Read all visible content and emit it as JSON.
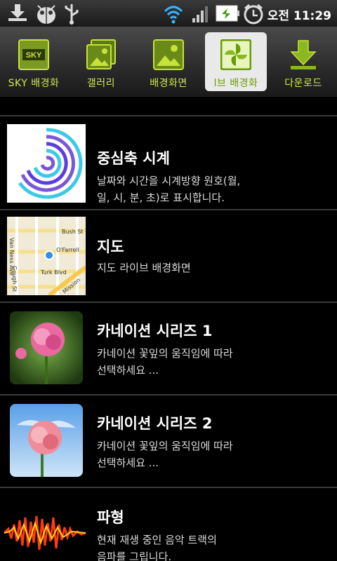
{
  "status_bar": {
    "time": "오전 11:29",
    "icons": [
      "download-icon",
      "bug-icon",
      "usb-icon",
      "wifi-icon",
      "signal-icon",
      "battery-charging-icon",
      "alarm-icon"
    ]
  },
  "tabs": [
    {
      "label": "SKY 배경화",
      "icon_text": "SKY",
      "icon": "sky-icon"
    },
    {
      "label": "갤러리",
      "icon": "gallery-icon"
    },
    {
      "label": "배경화면",
      "icon": "wallpaper-icon"
    },
    {
      "label": "l브 배경화",
      "icon": "live-wallpaper-icon",
      "active": true
    },
    {
      "label": "다운로드",
      "icon": "download-arrow-icon"
    }
  ],
  "items": [
    {
      "title": "중심축 시계",
      "desc_line1": "날짜와 시간을 시계방향 원호(월,",
      "desc_line2": "일, 시, 분, 초)로 표시합니다."
    },
    {
      "title": "지도",
      "desc_line1": "지도 라이브 배경화면",
      "desc_line2": "",
      "map_labels": [
        "Van Ness Ave",
        "Bush St",
        "O'Farrell",
        "Gough St",
        "Turk Blvd",
        "Mission"
      ]
    },
    {
      "title": "카네이션 시리즈 1",
      "desc_line1": "카네이션 꽃잎의 움직임에 따라",
      "desc_line2": "선택하세요 ..."
    },
    {
      "title": "카네이션 시리즈 2",
      "desc_line1": "카네이션 꽃잎의 움직임에 따라",
      "desc_line2": "선택하세요 ..."
    },
    {
      "title": "파형",
      "desc_line1": "현재 재생 중인 음악 트랙의",
      "desc_line2": "음파를 그립니다."
    }
  ],
  "colors": {
    "accent": "#c7e23b",
    "tab_active_bg": "#e9e9e9",
    "separator": "#3a3a3a"
  }
}
